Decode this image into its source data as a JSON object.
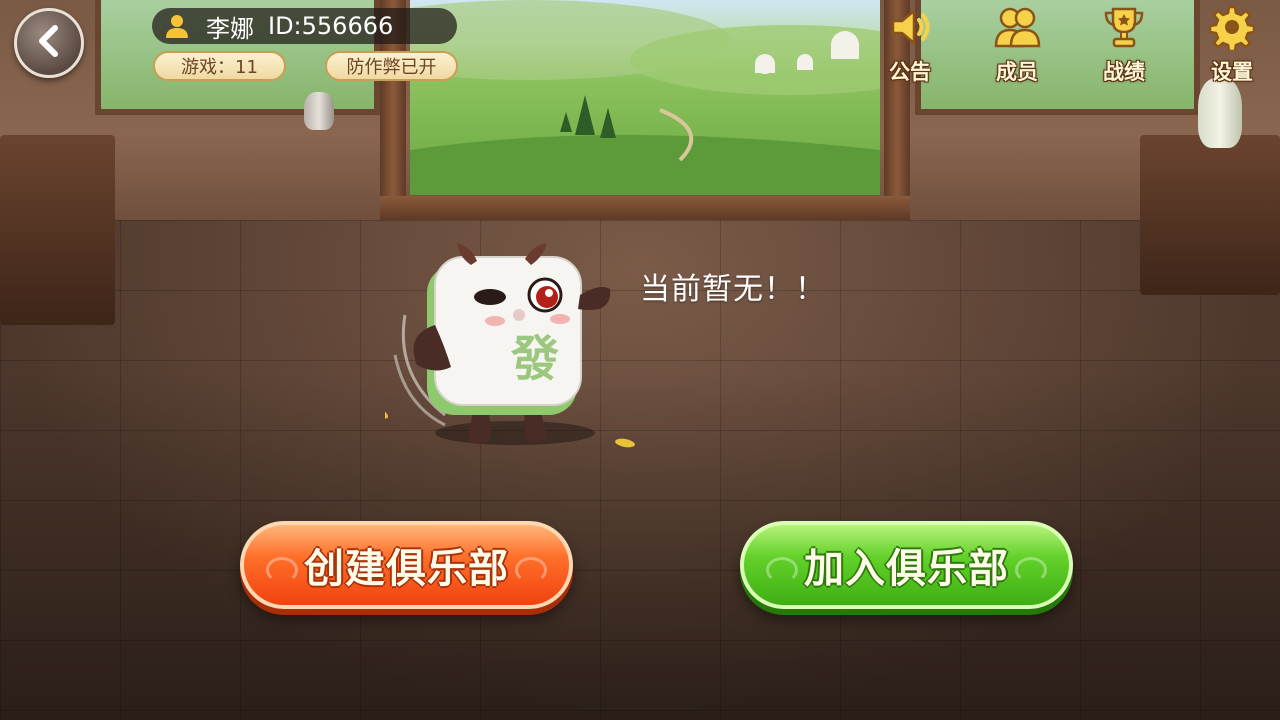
{
  "header": {
    "user_name": "李娜",
    "user_id": "ID:556666",
    "games_label": "游戏：11",
    "anticheat_label": "防作弊已开"
  },
  "top_menu": [
    {
      "label": "公告",
      "icon": "speaker-icon"
    },
    {
      "label": "成员",
      "icon": "members-icon"
    },
    {
      "label": "战绩",
      "icon": "trophy-icon"
    },
    {
      "label": "设置",
      "icon": "gear-icon"
    }
  ],
  "main": {
    "empty_message": "当前暂无！！",
    "mascot_tile_char": "發"
  },
  "actions": {
    "create_label": "创建俱乐部",
    "join_label": "加入俱乐部"
  },
  "colors": {
    "create_button": "#ff6f2a",
    "join_button": "#63d12a",
    "menu_gold": "#f5c542"
  }
}
